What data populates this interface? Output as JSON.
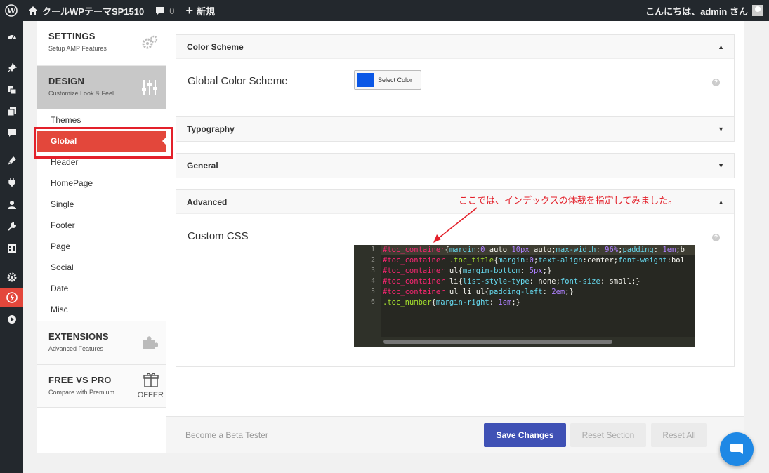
{
  "admin_bar": {
    "site_name": "クールWPテーマSP1510",
    "comments_count": "0",
    "new_label": "新規",
    "greeting": "こんにちは、admin さん"
  },
  "sidebar_icons": [
    "dashboard-icon",
    "pin-icon",
    "media-icon",
    "pages-icon",
    "comments-icon",
    "appearance-icon",
    "plugins-icon",
    "users-icon",
    "tools-icon",
    "widgets-icon",
    "settings-icon",
    "amp-icon",
    "play-icon"
  ],
  "nav": {
    "settings": {
      "title": "SETTINGS",
      "subtitle": "Setup AMP Features"
    },
    "design": {
      "title": "DESIGN",
      "subtitle": "Customize Look & Feel"
    },
    "items": [
      "Themes",
      "Global",
      "Header",
      "HomePage",
      "Single",
      "Footer",
      "Page",
      "Social",
      "Date",
      "Misc"
    ],
    "active_item": "Global",
    "extensions": {
      "title": "EXTENSIONS",
      "subtitle": "Advanced Features"
    },
    "freevspro": {
      "title": "FREE VS PRO",
      "subtitle": "Compare with Premium",
      "offer": "OFFER"
    }
  },
  "panels": {
    "color_scheme": {
      "title": "Color Scheme",
      "field_label": "Global Color Scheme",
      "button_label": "Select Color",
      "color": "#0a57e6"
    },
    "typography": {
      "title": "Typography"
    },
    "general": {
      "title": "General"
    },
    "advanced": {
      "title": "Advanced",
      "field_label": "Custom CSS"
    }
  },
  "annotation": "ここでは、インデックスの体裁を指定してみました。",
  "editor": {
    "line_numbers": [
      "1",
      "2",
      "3",
      "4",
      "5",
      "6"
    ],
    "lines": [
      "#toc_container{margin:0 auto 10px auto;max-width: 96%;padding: 1em;b",
      "#toc_container .toc_title{margin:0;text-align:center;font-weight:bol",
      "#toc_container ul{margin-bottom: 5px;}",
      "#toc_container li{list-style-type: none;font-size: small;}",
      "#toc_container ul li ul{padding-left: 2em;}",
      ".toc_number{margin-right: 1em;}"
    ]
  },
  "footer": {
    "beta_label": "Become a Beta Tester",
    "save_label": "Save Changes",
    "reset_section_label": "Reset Section",
    "reset_all_label": "Reset All"
  },
  "colors": {
    "accent": "#e3473b",
    "primary": "#3f51b5",
    "admin_bar": "#23282d",
    "chat": "#1e88e5"
  }
}
